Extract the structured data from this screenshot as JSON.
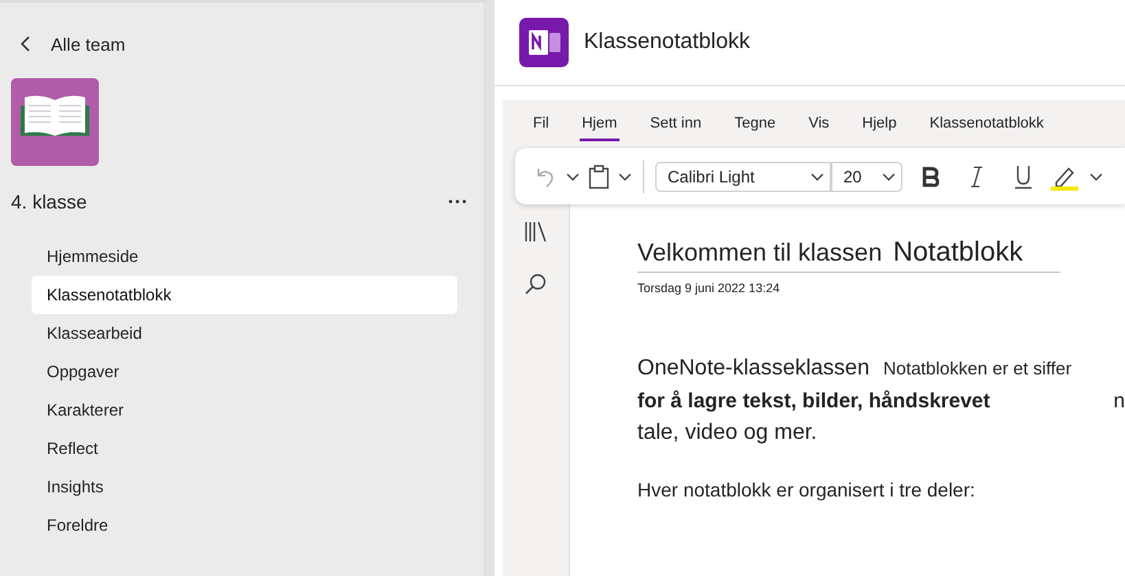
{
  "back_link": {
    "label": "Alle team"
  },
  "team": {
    "name": "4. klasse"
  },
  "nav": [
    {
      "label": "Hjemmeside",
      "selected": false
    },
    {
      "label": "Klassenotatblokk",
      "selected": true
    },
    {
      "label": "Klassearbeid",
      "selected": false
    },
    {
      "label": "Oppgaver",
      "selected": false
    },
    {
      "label": "Karakterer",
      "selected": false
    },
    {
      "label": "Reflect",
      "selected": false
    },
    {
      "label": "Insights",
      "selected": false
    },
    {
      "label": "Foreldre",
      "selected": false
    }
  ],
  "app": {
    "title": "Klassenotatblokk"
  },
  "ribbon_tabs": [
    {
      "label": "Fil",
      "selected": false
    },
    {
      "label": "Hjem",
      "selected": true
    },
    {
      "label": "Sett inn",
      "selected": false
    },
    {
      "label": "Tegne",
      "selected": false
    },
    {
      "label": "Vis",
      "selected": false
    },
    {
      "label": "Hjelp",
      "selected": false
    },
    {
      "label": "Klassenotatblokk",
      "selected": false
    }
  ],
  "toolbar": {
    "font": "Calibri Light",
    "size": "20"
  },
  "page": {
    "title": "Velkommen til klassen",
    "title_2": "Notatblokk",
    "date": "Torsdag 9 juni 2022 13:24",
    "lines": [
      {
        "segments": [
          {
            "text": "OneNote-klasseklassen",
            "kind": "large"
          },
          {
            "text": "Notatblokken er et siffer",
            "kind": "small"
          }
        ]
      },
      {
        "segments": [
          {
            "text": "for å lagre tekst, bilder, håndskrevet",
            "kind": "bold"
          },
          {
            "text": "n",
            "kind": "edge"
          }
        ]
      },
      {
        "segments": [
          {
            "text": "tale, video og mer.",
            "kind": "large"
          }
        ]
      },
      {
        "segments": [
          {
            "text": "Hver notatblokk er organisert i tre deler:",
            "kind": "medium"
          }
        ],
        "gap": true
      }
    ]
  }
}
